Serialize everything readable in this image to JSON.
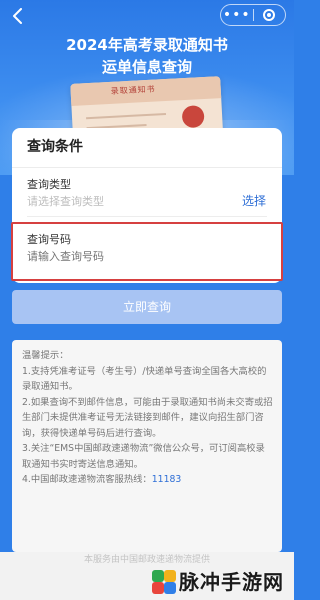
{
  "topbar": {
    "more_icon": "more-dots-icon",
    "close_icon": "mini-program-close-icon",
    "more_glyph": "•••"
  },
  "hero": {
    "title_line1": "2024年高考录取通知书",
    "title_line2": "运单信息查询",
    "envelope_stamp": "录取通知书"
  },
  "query": {
    "title": "查询条件",
    "type_label": "查询类型",
    "type_placeholder": "请选择查询类型",
    "select_label": "选择",
    "number_label": "查询号码",
    "number_placeholder": "请输入查询号码",
    "submit_label": "立即查询"
  },
  "tips": {
    "heading": "温馨提示：",
    "items": [
      "1.支持凭准考证号（考生号）/快递单号查询全国各大高校的录取通知书。",
      "2.如果查询不到邮件信息，可能由于录取通知书尚未交寄或招生部门未提供准考证号无法链接到邮件，建议向招生部门咨询，获得快递单号码后进行查询。",
      "3.关注“EMS中国邮政速递物流”微信公众号，可订阅高校录取通知书实时寄送信息通知。"
    ],
    "hotline_prefix": "4.中国邮政速递物流客服热线：",
    "hotline_number": "11183"
  },
  "footer": {
    "text": "本服务由中国邮政速递物流提供"
  },
  "watermark": {
    "text": "脉冲手游网"
  },
  "colors": {
    "brand_blue": "#2f7fe8",
    "link_blue": "#2f6fd6",
    "button_disabled": "#a8c4f3",
    "highlight_red": "#d64040"
  }
}
